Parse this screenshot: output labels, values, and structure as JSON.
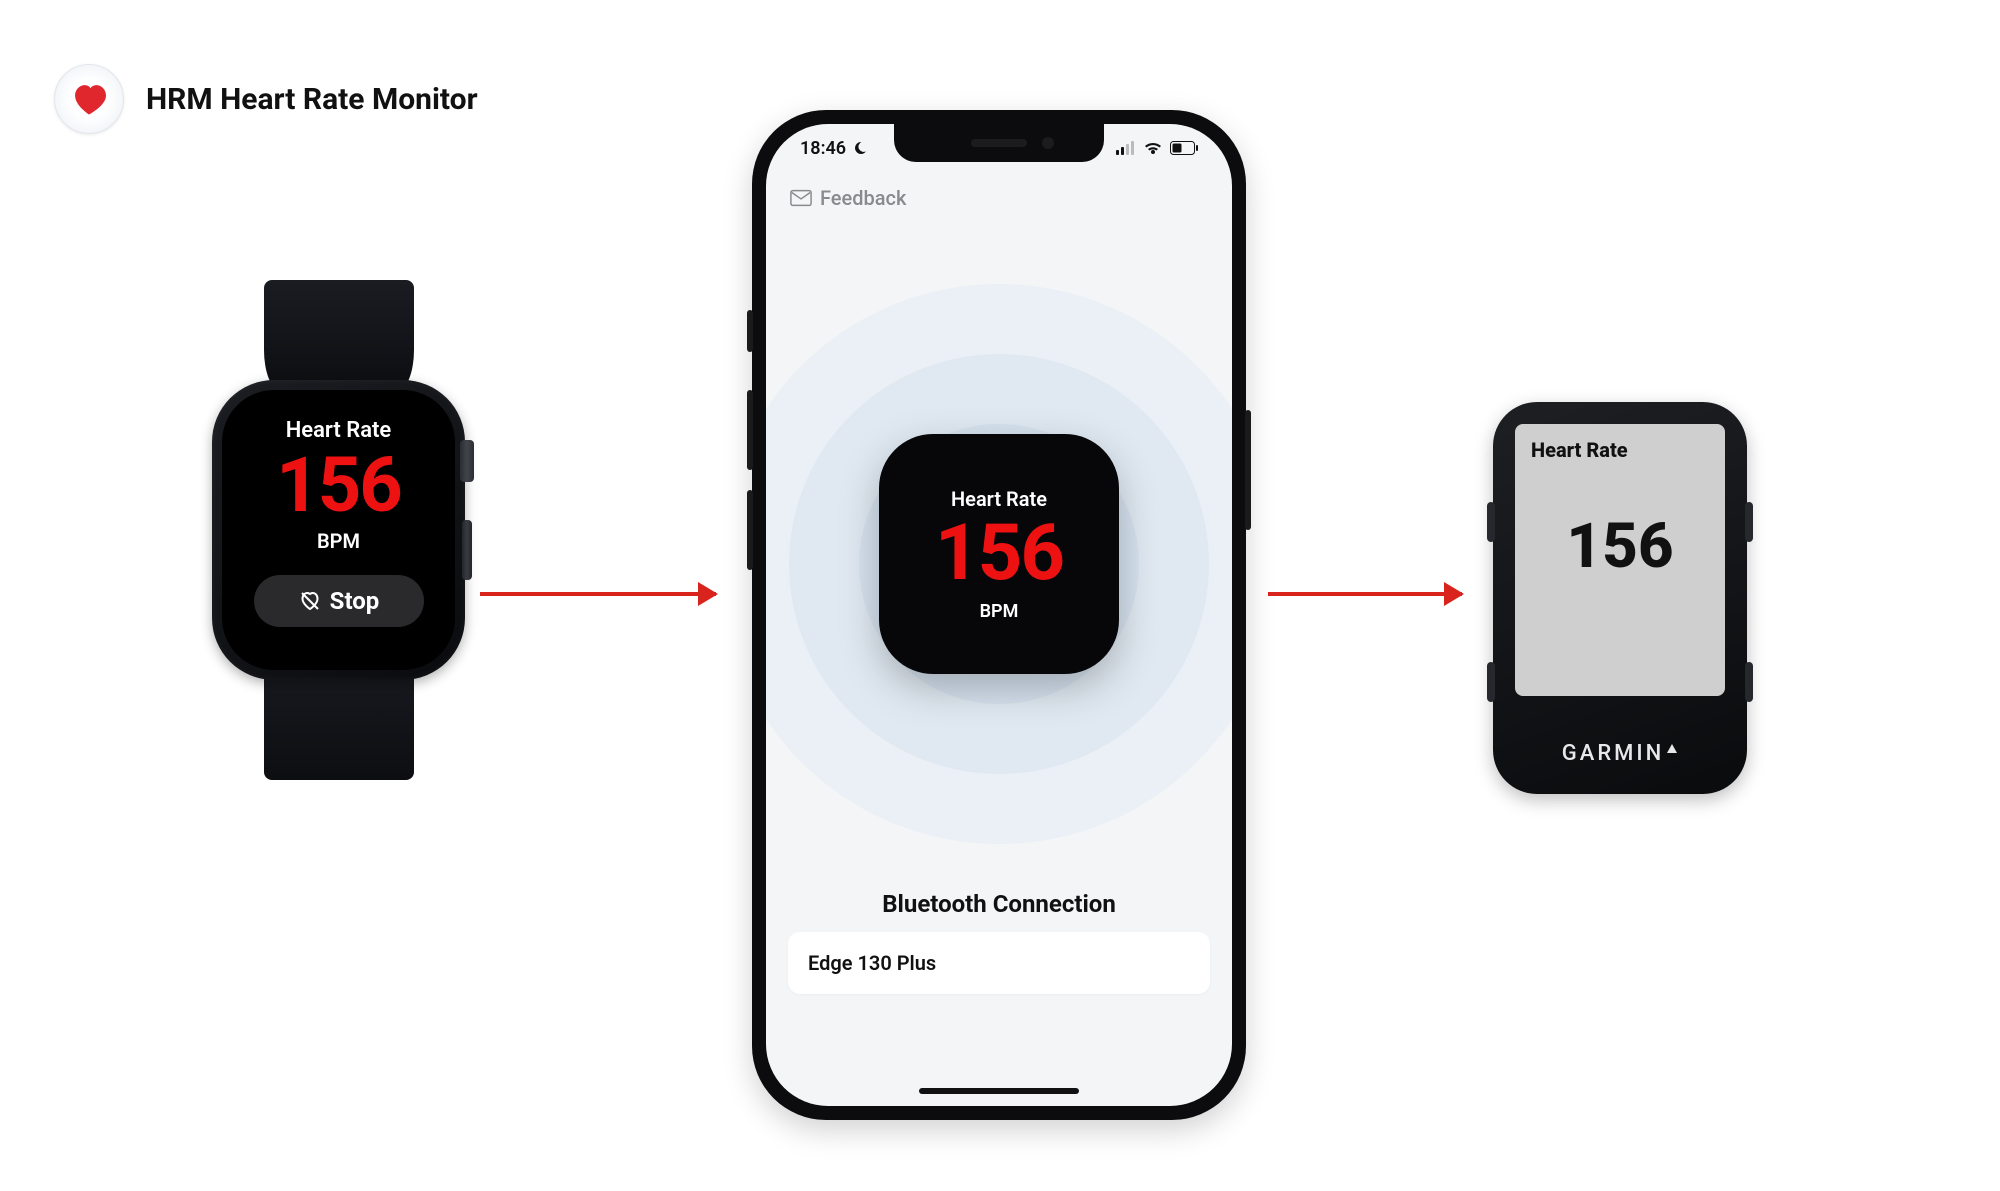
{
  "header": {
    "title": "HRM Heart Rate Monitor"
  },
  "watch": {
    "label": "Heart Rate",
    "value": "156",
    "unit": "BPM",
    "stop_label": "Stop"
  },
  "phone": {
    "status": {
      "time": "18:46"
    },
    "feedback_label": "Feedback",
    "card": {
      "label": "Heart Rate",
      "value": "156",
      "unit": "BPM"
    },
    "bluetooth": {
      "title": "Bluetooth Connection",
      "device": "Edge 130 Plus"
    }
  },
  "garmin": {
    "label": "Heart Rate",
    "value": "156",
    "brand": "GARMIN"
  }
}
